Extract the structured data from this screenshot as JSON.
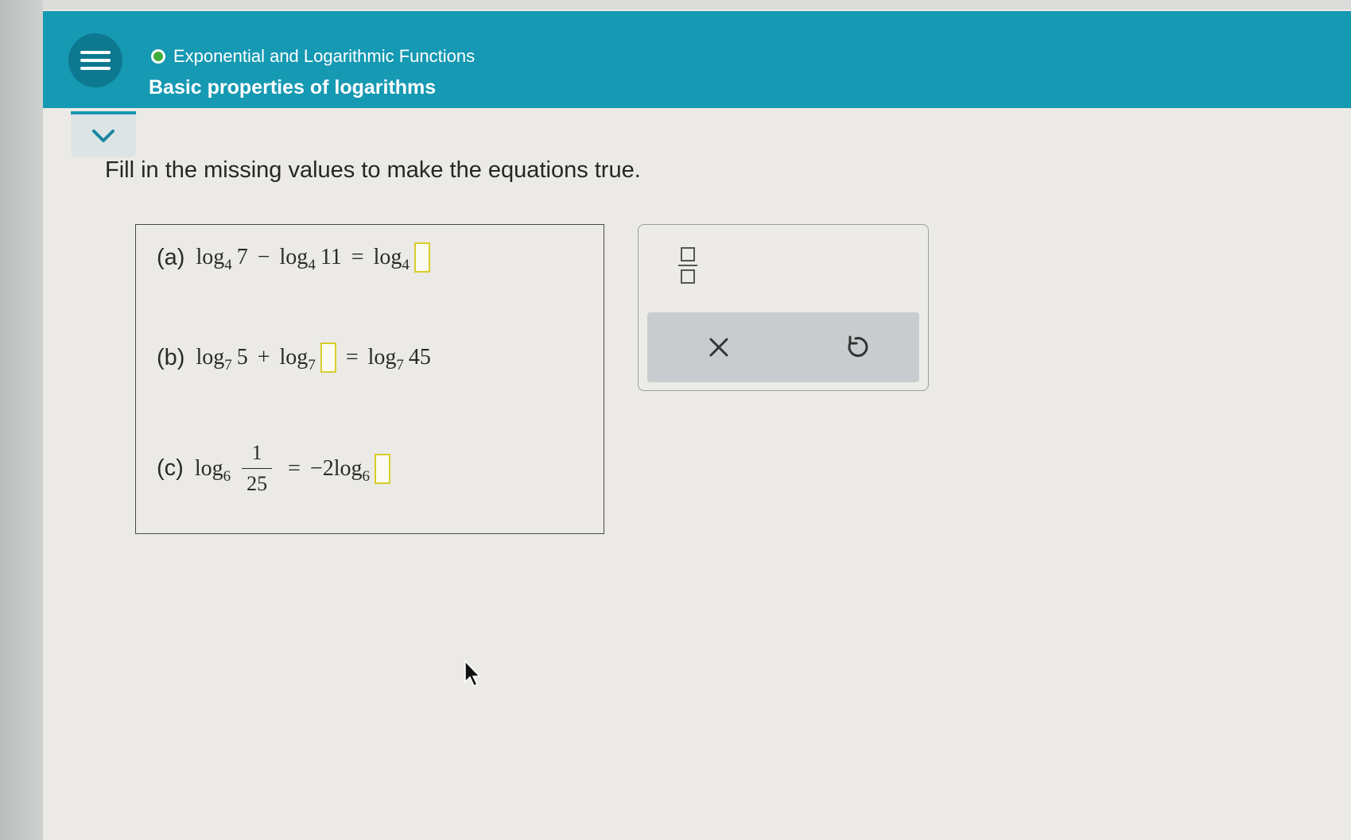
{
  "header": {
    "topic": "Exponential and Logarithmic Functions",
    "lesson": "Basic properties of logarithms",
    "accent_color": "#1699b3",
    "status_color": "#3fae3a"
  },
  "instruction": "Fill in the missing values to make the equations true.",
  "problems": {
    "a": {
      "label": "(a)",
      "log": "log",
      "base": "4",
      "arg1": "7",
      "op": "−",
      "arg2": "11",
      "eq": "=",
      "answer": ""
    },
    "b": {
      "label": "(b)",
      "log": "log",
      "base": "7",
      "arg1": "5",
      "op": "+",
      "eq": "=",
      "rhs_arg": "45",
      "answer": ""
    },
    "c": {
      "label": "(c)",
      "log": "log",
      "base": "6",
      "num": "1",
      "den": "25",
      "eq": "=",
      "coef": "−2",
      "answer": ""
    }
  },
  "tools": {
    "fraction_icon": "fraction-template-icon",
    "clear_icon": "close-icon",
    "undo_icon": "undo-icon"
  }
}
